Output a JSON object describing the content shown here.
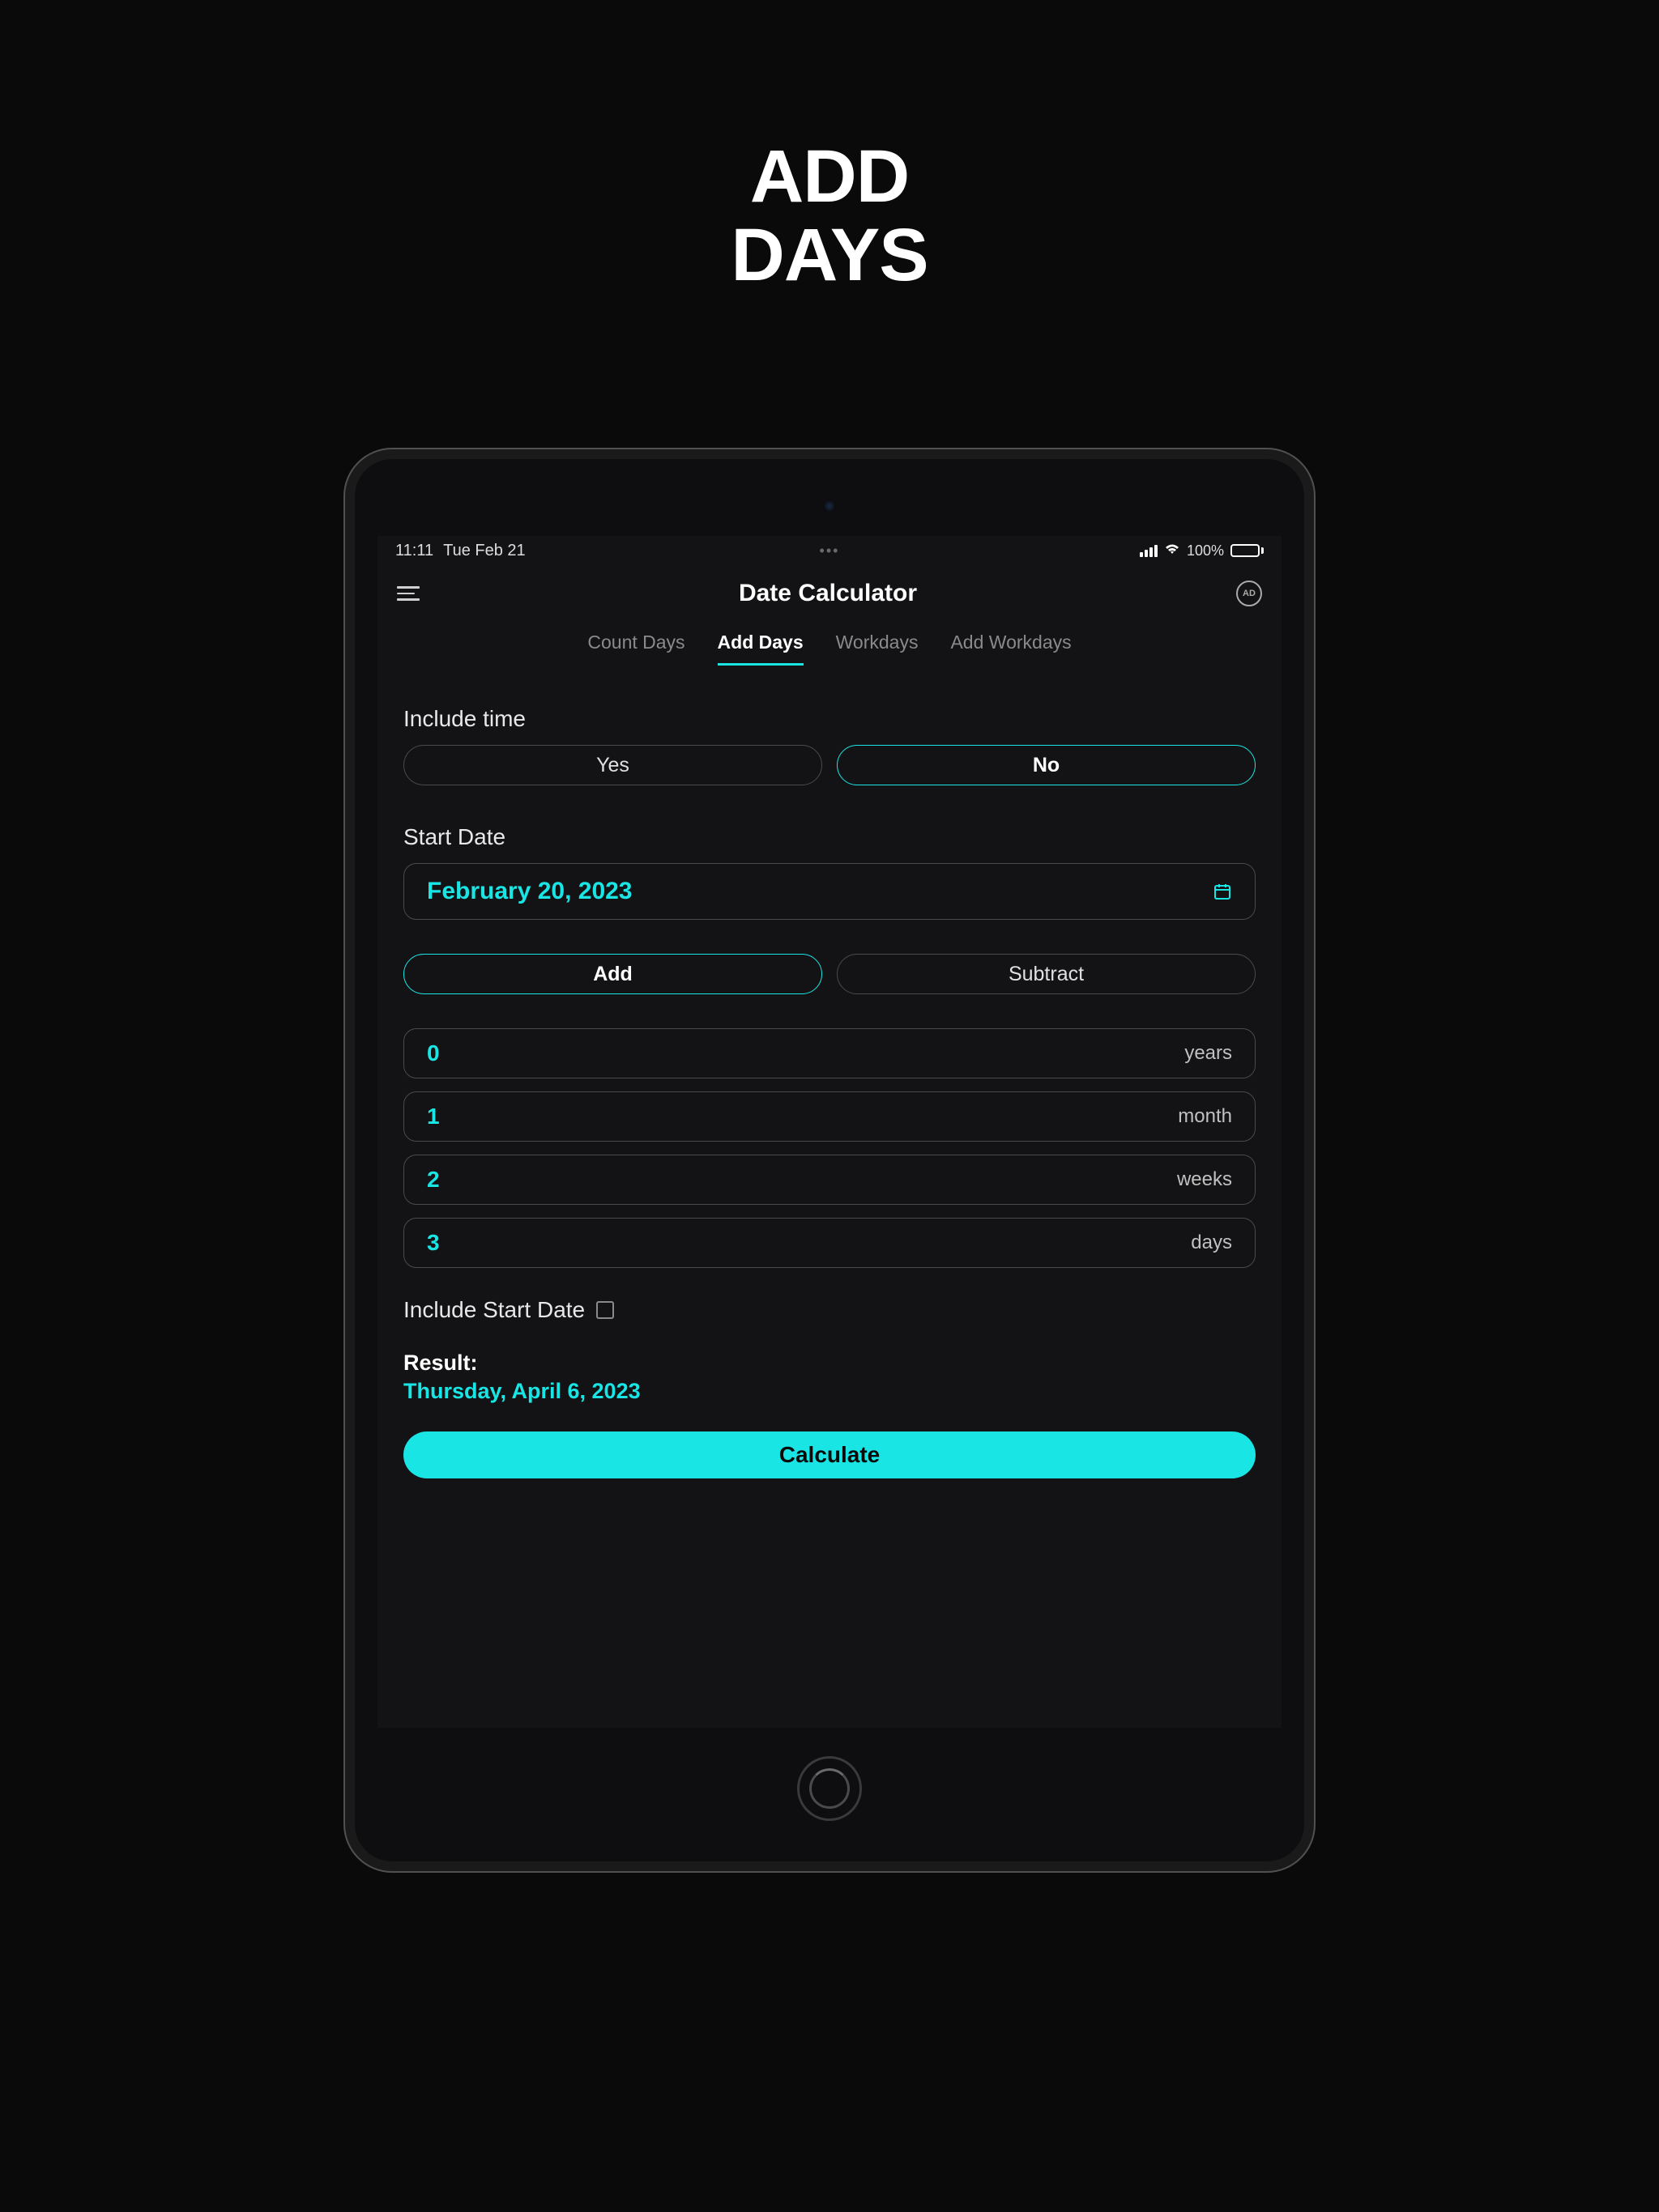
{
  "hero": {
    "line1": "ADD",
    "line2": "DAYS"
  },
  "status": {
    "time": "11:11",
    "date": "Tue Feb 21",
    "battery": "100%"
  },
  "header": {
    "title": "Date Calculator",
    "ad_label": "AD"
  },
  "tabs": {
    "count_days": "Count Days",
    "add_days": "Add Days",
    "workdays": "Workdays",
    "add_workdays": "Add Workdays"
  },
  "include_time": {
    "label": "Include time",
    "yes": "Yes",
    "no": "No"
  },
  "start_date": {
    "label": "Start Date",
    "value": "February 20, 2023"
  },
  "operation": {
    "add": "Add",
    "subtract": "Subtract"
  },
  "inputs": {
    "years": {
      "value": "0",
      "unit": "years"
    },
    "months": {
      "value": "1",
      "unit": "month"
    },
    "weeks": {
      "value": "2",
      "unit": "weeks"
    },
    "days": {
      "value": "3",
      "unit": "days"
    }
  },
  "include_start": {
    "label": "Include Start Date"
  },
  "result": {
    "label": "Result:",
    "value": "Thursday, April 6, 2023"
  },
  "calculate": {
    "label": "Calculate"
  }
}
